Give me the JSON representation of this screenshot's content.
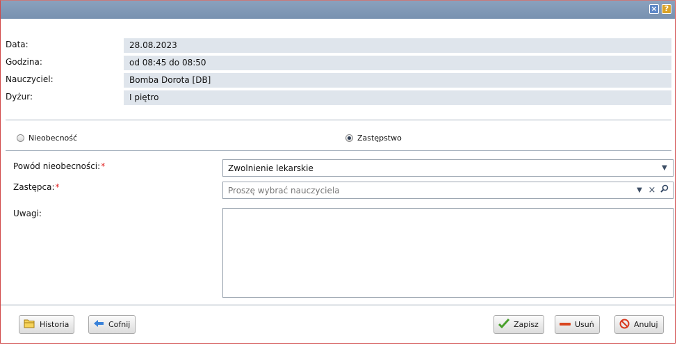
{
  "titlebar": {
    "close_icon": "close-icon",
    "help_icon": "help-icon"
  },
  "info": [
    {
      "label": "Data:",
      "value": "28.08.2023"
    },
    {
      "label": "Godzina:",
      "value": "od 08:45 do 08:50"
    },
    {
      "label": "Nauczyciel:",
      "value": "Bomba Dorota [DB]"
    },
    {
      "label": "Dyżur:",
      "value": "I piętro"
    }
  ],
  "mode": {
    "option1": "Nieobecność",
    "option2": "Zastępstwo",
    "selected": "Zastępstwo"
  },
  "form": {
    "reason_label": "Powód nieobecności:",
    "reason_value": "Zwolnienie lekarskie",
    "substitute_label": "Zastępca:",
    "substitute_placeholder": "Proszę wybrać nauczyciela",
    "notes_label": "Uwagi:",
    "notes_value": "",
    "required_mark": "*"
  },
  "buttons": {
    "history": "Historia",
    "back": "Cofnij",
    "save": "Zapisz",
    "delete": "Usuń",
    "cancel": "Anuluj"
  },
  "colors": {
    "titlebar": "#7f97b6",
    "field_bg": "#dfe5ec",
    "required": "#e02020",
    "dialog_border": "#d04848"
  }
}
